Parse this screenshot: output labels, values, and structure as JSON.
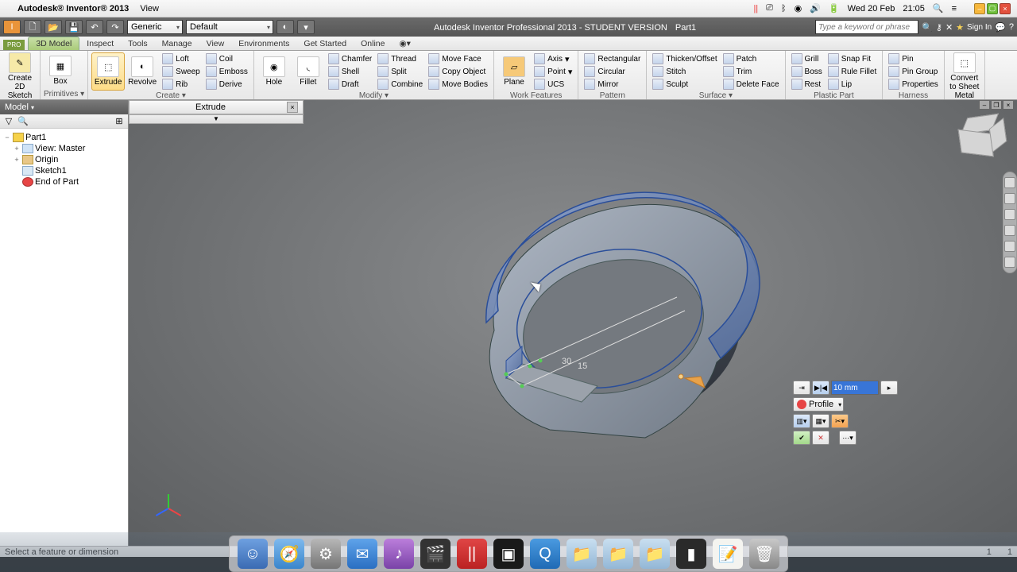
{
  "mac_menu": {
    "app": "Autodesk® Inventor® 2013",
    "view": "View",
    "date": "Wed 20 Feb",
    "time": "21:05"
  },
  "qat": {
    "material": "Generic",
    "appearance": "Default",
    "title": "Autodesk Inventor Professional 2013 - STUDENT VERSION",
    "doc": "Part1",
    "search_ph": "Type a keyword or phrase",
    "signin": "Sign In"
  },
  "tabs": {
    "pro": "PRO",
    "items": [
      "3D Model",
      "Inspect",
      "Tools",
      "Manage",
      "View",
      "Environments",
      "Get Started",
      "Online"
    ]
  },
  "ribbon": {
    "sketch": {
      "label": "Sketch",
      "create": "Create\n2D Sketch"
    },
    "primitives": {
      "label": "Primitives",
      "box": "Box"
    },
    "create": {
      "label": "Create",
      "extrude": "Extrude",
      "revolve": "Revolve",
      "loft": "Loft",
      "sweep": "Sweep",
      "rib": "Rib",
      "coil": "Coil",
      "emboss": "Emboss",
      "derive": "Derive"
    },
    "modify": {
      "label": "Modify",
      "hole": "Hole",
      "fillet": "Fillet",
      "chamfer": "Chamfer",
      "shell": "Shell",
      "draft": "Draft",
      "thread": "Thread",
      "split": "Split",
      "combine": "Combine",
      "moveface": "Move Face",
      "copyobj": "Copy Object",
      "movebodies": "Move Bodies"
    },
    "workfeat": {
      "label": "Work Features",
      "plane": "Plane",
      "axis": "Axis",
      "point": "Point",
      "ucs": "UCS"
    },
    "pattern": {
      "label": "Pattern",
      "rect": "Rectangular",
      "circ": "Circular",
      "mirror": "Mirror"
    },
    "surface": {
      "label": "Surface",
      "thicken": "Thicken/Offset",
      "stitch": "Stitch",
      "sculpt": "Sculpt",
      "patch": "Patch",
      "trim": "Trim",
      "delface": "Delete Face"
    },
    "plastic": {
      "label": "Plastic Part",
      "grill": "Grill",
      "boss": "Boss",
      "rest": "Rest",
      "snap": "Snap Fit",
      "rule": "Rule Fillet",
      "lip": "Lip"
    },
    "harness": {
      "label": "Harness",
      "pin": "Pin",
      "pingroup": "Pin Group",
      "props": "Properties"
    },
    "convert": {
      "label": "Convert",
      "sheet": "Convert to\nSheet Metal"
    }
  },
  "extrude": {
    "title": "Extrude"
  },
  "browser": {
    "hdr": "Model",
    "part": "Part1",
    "view": "View: Master",
    "origin": "Origin",
    "sketch": "Sketch1",
    "end": "End of Part"
  },
  "dims": {
    "d1": "30",
    "d2": "15"
  },
  "minidlg": {
    "value": "10 mm",
    "profile": "Profile"
  },
  "status": {
    "msg": "Select a feature or dimension",
    "n1": "1",
    "n2": "1"
  }
}
